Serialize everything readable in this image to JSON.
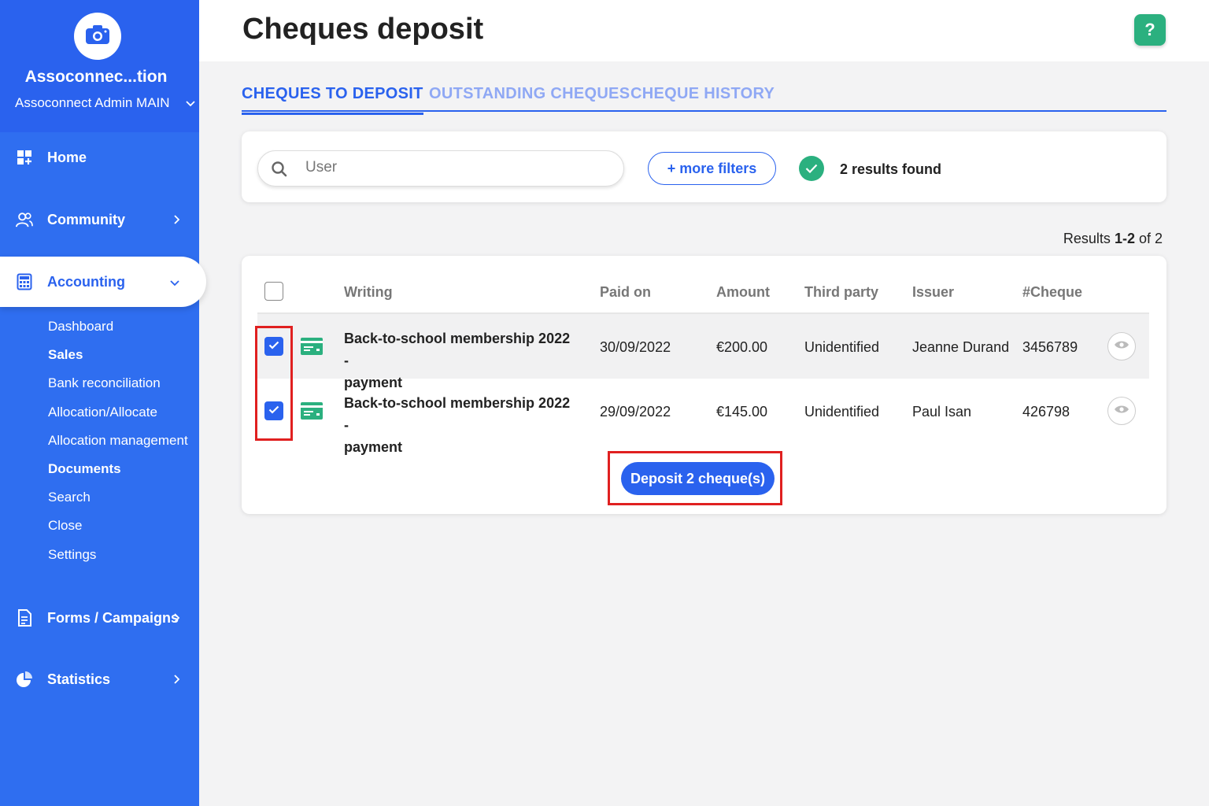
{
  "sidebar": {
    "org_name": "Assoconnec...tion",
    "account": "Assoconnect Admin MAIN",
    "nav": {
      "home": "Home",
      "community": "Community",
      "accounting": "Accounting",
      "forms": "Forms / Campaigns",
      "statistics": "Statistics"
    },
    "accounting_sub": [
      "Dashboard",
      "Sales",
      "Bank reconciliation",
      "Allocation/Allocate",
      "Allocation management",
      "Documents",
      "Search",
      "Close",
      "Settings"
    ]
  },
  "header": {
    "title": "Cheques deposit",
    "help": "?"
  },
  "tabs": [
    "CHEQUES TO DEPOSIT",
    "OUTSTANDING CHEQUES",
    "CHEQUE HISTORY"
  ],
  "filters": {
    "search_placeholder": "User",
    "more_filters": "+ more filters",
    "results_found": "2 results found"
  },
  "results": {
    "label": "Results",
    "range": "1-2",
    "of": "of 2"
  },
  "table": {
    "columns": [
      "Writing",
      "Paid on",
      "Amount",
      "Third party",
      "Issuer",
      "#Cheque"
    ],
    "rows": [
      {
        "writing_1": "Back-to-school membership 2022 -",
        "writing_2": "payment",
        "paid_on": "30/09/2022",
        "amount": "€200.00",
        "third_party": "Unidentified",
        "issuer": "Jeanne Durand",
        "cheque": "3456789",
        "checked": true
      },
      {
        "writing_1": "Back-to-school membership 2022 -",
        "writing_2": "payment",
        "paid_on": "29/09/2022",
        "amount": "€145.00",
        "third_party": "Unidentified",
        "issuer": "Paul Isan",
        "cheque": "426798",
        "checked": true
      }
    ]
  },
  "deposit_button": "Deposit 2 cheque(s)",
  "colors": {
    "sidebar": "#2f6ef0",
    "primary": "#2a62ee",
    "success": "#2bb07f",
    "highlight": "#e02020"
  },
  "icons": [
    "camera-icon",
    "home-icon",
    "community-icon",
    "calculator-icon",
    "forms-icon",
    "statistics-icon",
    "search-icon",
    "check-icon",
    "cheque-icon",
    "eye-icon",
    "chevron-down-icon",
    "chevron-right-icon"
  ]
}
